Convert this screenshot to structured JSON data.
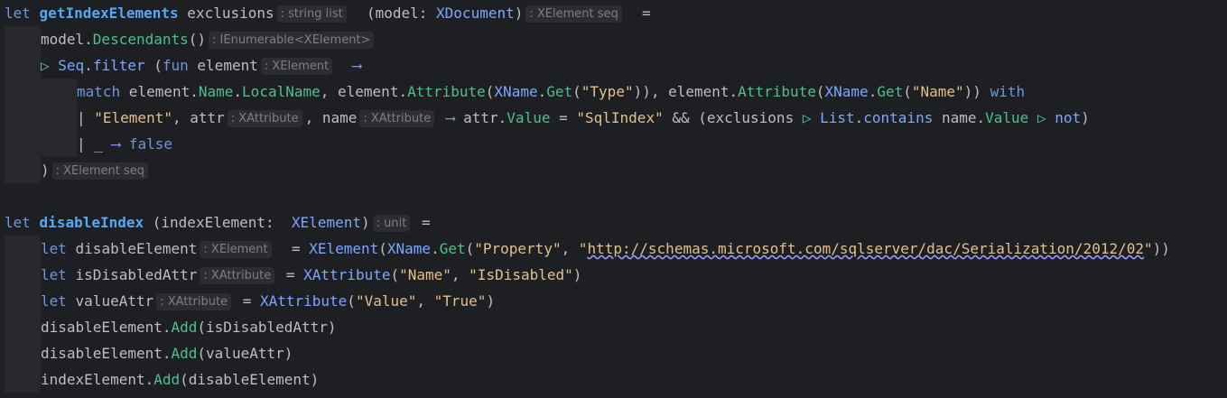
{
  "editor": {
    "lines": [
      [
        {
          "t": "let",
          "c": "kw"
        },
        {
          "t": " ",
          "c": "id"
        },
        {
          "t": "getIndexElements",
          "c": "fn"
        },
        {
          "t": " exclusions",
          "c": "id"
        },
        {
          "t": ": string list",
          "h": true
        },
        {
          "t": "  (model: ",
          "c": "id"
        },
        {
          "t": "XDocument",
          "c": "ty"
        },
        {
          "t": ")",
          "c": "id"
        },
        {
          "t": ": XElement seq",
          "h": true
        },
        {
          "t": "  =",
          "c": "id"
        }
      ],
      [
        {
          "t": "model.",
          "c": "id"
        },
        {
          "t": "Descendants",
          "c": "prop"
        },
        {
          "t": "()",
          "c": "id"
        },
        {
          "t": ": IEnumerable<XElement>",
          "h": true
        }
      ],
      [
        {
          "t": "▷ ",
          "c": "pipe"
        },
        {
          "t": "Seq",
          "c": "ty"
        },
        {
          "t": ".",
          "c": "id"
        },
        {
          "t": "filter",
          "c": "ty"
        },
        {
          "t": " (",
          "c": "id"
        },
        {
          "t": "fun",
          "c": "kw"
        },
        {
          "t": " element",
          "c": "id"
        },
        {
          "t": ": XElement",
          "h": true
        },
        {
          "t": "  ",
          "c": "id"
        },
        {
          "t": "⟶",
          "c": "arrow"
        }
      ],
      [
        {
          "t": "match",
          "c": "kw"
        },
        {
          "t": " element.",
          "c": "id"
        },
        {
          "t": "Name",
          "c": "prop"
        },
        {
          "t": ".",
          "c": "id"
        },
        {
          "t": "LocalName",
          "c": "prop"
        },
        {
          "t": ", element.",
          "c": "id"
        },
        {
          "t": "Attribute",
          "c": "prop"
        },
        {
          "t": "(",
          "c": "id"
        },
        {
          "t": "XName",
          "c": "ty"
        },
        {
          "t": ".",
          "c": "id"
        },
        {
          "t": "Get",
          "c": "prop"
        },
        {
          "t": "(",
          "c": "id"
        },
        {
          "t": "\"Type\"",
          "c": "str-yellow"
        },
        {
          "t": ")), element.",
          "c": "id"
        },
        {
          "t": "Attribute",
          "c": "prop"
        },
        {
          "t": "(",
          "c": "id"
        },
        {
          "t": "XName",
          "c": "ty"
        },
        {
          "t": ".",
          "c": "id"
        },
        {
          "t": "Get",
          "c": "prop"
        },
        {
          "t": "(",
          "c": "id"
        },
        {
          "t": "\"Name\"",
          "c": "str-yellow"
        },
        {
          "t": ")) ",
          "c": "id"
        },
        {
          "t": "with",
          "c": "kw"
        }
      ],
      [
        {
          "t": "| ",
          "c": "id"
        },
        {
          "t": "\"Element\"",
          "c": "str-yellow"
        },
        {
          "t": ", attr",
          "c": "id"
        },
        {
          "t": ": XAttribute",
          "h": true
        },
        {
          "t": ", name",
          "c": "id"
        },
        {
          "t": ": XAttribute",
          "h": true
        },
        {
          "t": " ",
          "c": "id"
        },
        {
          "t": "⟶",
          "c": "arrow"
        },
        {
          "t": " attr.",
          "c": "id"
        },
        {
          "t": "Value",
          "c": "prop"
        },
        {
          "t": " = ",
          "c": "id"
        },
        {
          "t": "\"SqlIndex\"",
          "c": "str-yellow"
        },
        {
          "t": " && (exclusions ",
          "c": "id"
        },
        {
          "t": "▷ ",
          "c": "pipe"
        },
        {
          "t": "List",
          "c": "ty"
        },
        {
          "t": ".",
          "c": "id"
        },
        {
          "t": "contains",
          "c": "ty"
        },
        {
          "t": " name.",
          "c": "id"
        },
        {
          "t": "Value",
          "c": "prop"
        },
        {
          "t": " ",
          "c": "id"
        },
        {
          "t": "▷ ",
          "c": "pipe"
        },
        {
          "t": "not",
          "c": "ty"
        },
        {
          "t": ")",
          "c": "id"
        }
      ],
      [
        {
          "t": "| _ ",
          "c": "id"
        },
        {
          "t": "⟶",
          "c": "arrow"
        },
        {
          "t": " ",
          "c": "id"
        },
        {
          "t": "false",
          "c": "kw"
        }
      ],
      [
        {
          "t": ")",
          "c": "id"
        },
        {
          "t": ": XElement seq",
          "h": true
        }
      ],
      [],
      [
        {
          "t": "let",
          "c": "kw"
        },
        {
          "t": " ",
          "c": "id"
        },
        {
          "t": "disableIndex",
          "c": "fn"
        },
        {
          "t": " (indexElement:  ",
          "c": "id"
        },
        {
          "t": "XElement",
          "c": "ty"
        },
        {
          "t": ")",
          "c": "id"
        },
        {
          "t": ": unit",
          "h": true
        },
        {
          "t": " =",
          "c": "id"
        }
      ],
      [
        {
          "t": "let",
          "c": "kw"
        },
        {
          "t": " disableElement",
          "c": "id"
        },
        {
          "t": ": XElement",
          "h": true
        },
        {
          "t": "  = ",
          "c": "id"
        },
        {
          "t": "XElement",
          "c": "ty"
        },
        {
          "t": "(",
          "c": "id"
        },
        {
          "t": "XName",
          "c": "ty"
        },
        {
          "t": ".",
          "c": "id"
        },
        {
          "t": "Get",
          "c": "prop"
        },
        {
          "t": "(",
          "c": "id"
        },
        {
          "t": "\"Property\"",
          "c": "str-yellow"
        },
        {
          "t": ", ",
          "c": "id"
        },
        {
          "t": "\"",
          "c": "str-yellow"
        },
        {
          "t": "http://schemas.microsoft.com/sqlserver/dac/Serialization/2012/02",
          "c": "str-yellow",
          "u": true
        },
        {
          "t": "\"",
          "c": "str-yellow"
        },
        {
          "t": "))",
          "c": "id"
        }
      ],
      [
        {
          "t": "let",
          "c": "kw"
        },
        {
          "t": " isDisabledAttr",
          "c": "id"
        },
        {
          "t": ": XAttribute",
          "h": true
        },
        {
          "t": " = ",
          "c": "id"
        },
        {
          "t": "XAttribute",
          "c": "ty"
        },
        {
          "t": "(",
          "c": "id"
        },
        {
          "t": "\"Name\"",
          "c": "str-yellow"
        },
        {
          "t": ", ",
          "c": "id"
        },
        {
          "t": "\"IsDisabled\"",
          "c": "str-yellow"
        },
        {
          "t": ")",
          "c": "id"
        }
      ],
      [
        {
          "t": "let",
          "c": "kw"
        },
        {
          "t": " valueAttr",
          "c": "id"
        },
        {
          "t": ": XAttribute",
          "h": true
        },
        {
          "t": " = ",
          "c": "id"
        },
        {
          "t": "XAttribute",
          "c": "ty"
        },
        {
          "t": "(",
          "c": "id"
        },
        {
          "t": "\"Value\"",
          "c": "str-yellow"
        },
        {
          "t": ", ",
          "c": "id"
        },
        {
          "t": "\"True\"",
          "c": "str-yellow"
        },
        {
          "t": ")",
          "c": "id"
        }
      ],
      [
        {
          "t": "disableElement.",
          "c": "id"
        },
        {
          "t": "Add",
          "c": "prop"
        },
        {
          "t": "(isDisabledAttr)",
          "c": "id"
        }
      ],
      [
        {
          "t": "disableElement.",
          "c": "id"
        },
        {
          "t": "Add",
          "c": "prop"
        },
        {
          "t": "(valueAttr)",
          "c": "id"
        }
      ],
      [
        {
          "t": "indexElement.",
          "c": "id"
        },
        {
          "t": "Add",
          "c": "prop"
        },
        {
          "t": "(disableElement)",
          "c": "id"
        }
      ]
    ]
  }
}
